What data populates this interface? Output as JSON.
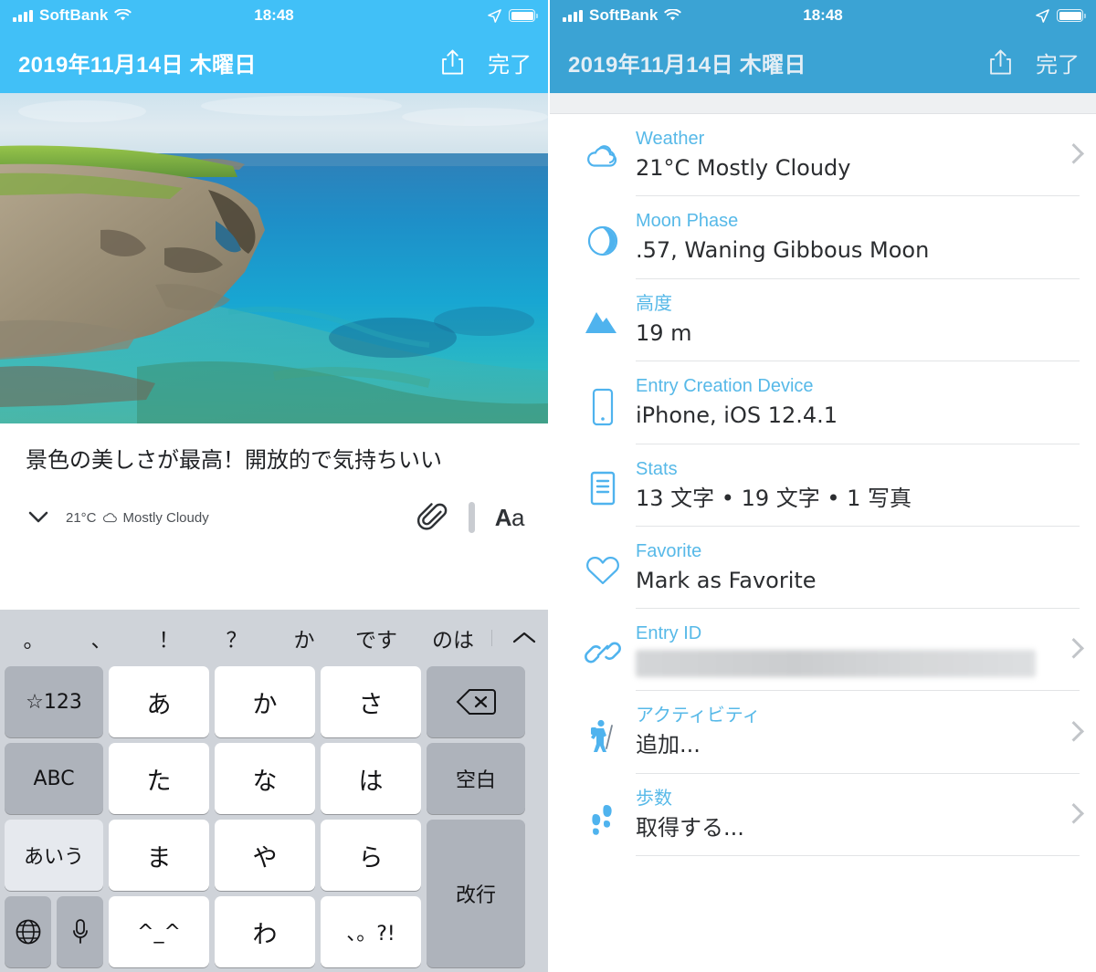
{
  "status_bar": {
    "carrier": "SoftBank",
    "time": "18:48",
    "wifi_icon": "wifi-icon",
    "signal_icon": "cellular-signal-icon",
    "location_icon": "location-arrow-icon",
    "battery_icon": "battery-full-icon"
  },
  "nav": {
    "title": "2019年11月14日 木曜日",
    "share_icon": "share-icon",
    "done_label": "完了"
  },
  "entry": {
    "photo_alt": "coastal-cliff-photo",
    "text": "景色の美しさが最高！開放的で気持ちいい",
    "weather_summary": "21°C",
    "weather_icon": "cloud-icon",
    "weather_condition": "Mostly Cloudy",
    "chevron_icon": "chevron-down-icon",
    "attach_icon": "paperclip-icon",
    "format_label": "Aa"
  },
  "keyboard": {
    "suggestions": [
      "。",
      "、",
      "！",
      "？",
      "か",
      "です",
      "のは"
    ],
    "collapse_icon": "chevron-up-icon",
    "rows": [
      [
        {
          "label": "☆123",
          "type": "fn",
          "name": "key-symbols"
        },
        {
          "label": "あ",
          "type": "main",
          "name": "key-a"
        },
        {
          "label": "か",
          "type": "main",
          "name": "key-ka"
        },
        {
          "label": "さ",
          "type": "main",
          "name": "key-sa"
        },
        {
          "label": "⌫",
          "type": "fn",
          "name": "key-delete"
        }
      ],
      [
        {
          "label": "ABC",
          "type": "fn",
          "name": "key-abc"
        },
        {
          "label": "た",
          "type": "main",
          "name": "key-ta"
        },
        {
          "label": "な",
          "type": "main",
          "name": "key-na"
        },
        {
          "label": "は",
          "type": "main",
          "name": "key-ha"
        },
        {
          "label": "空白",
          "type": "fn",
          "name": "key-space"
        }
      ],
      [
        {
          "label": "あいう",
          "type": "fn2",
          "name": "key-kana"
        },
        {
          "label": "ま",
          "type": "main",
          "name": "key-ma"
        },
        {
          "label": "や",
          "type": "main",
          "name": "key-ya"
        },
        {
          "label": "ら",
          "type": "main",
          "name": "key-ra"
        },
        {
          "label": "改行",
          "type": "fn",
          "name": "key-return"
        }
      ],
      [
        {
          "label": "🌐",
          "type": "fn",
          "name": "key-globe"
        },
        {
          "label": "🎤",
          "type": "fn",
          "name": "key-dictation"
        },
        {
          "label": "^_^",
          "type": "main",
          "name": "key-emoticon"
        },
        {
          "label": "わ",
          "type": "main",
          "name": "key-wa"
        },
        {
          "label": "、。?!",
          "type": "main",
          "name": "key-punctuation"
        }
      ]
    ]
  },
  "metadata": {
    "rows": [
      {
        "label": "Weather",
        "value": "21°C Mostly Cloudy",
        "icon": "cloud-icon",
        "name": "weather",
        "chevron": true,
        "redacted": false
      },
      {
        "label": "Moon Phase",
        "value": ".57, Waning Gibbous Moon",
        "icon": "moon-icon",
        "name": "moon-phase",
        "chevron": false,
        "redacted": false
      },
      {
        "label": "高度",
        "value": "19 m",
        "icon": "mountain-icon",
        "name": "altitude",
        "chevron": false,
        "redacted": false
      },
      {
        "label": "Entry Creation Device",
        "value": "iPhone, iOS 12.4.1",
        "icon": "phone-icon",
        "name": "entry-creation-device",
        "chevron": false,
        "redacted": false
      },
      {
        "label": "Stats",
        "value": "13 文字 • 19 文字 • 1 写真",
        "icon": "document-icon",
        "name": "stats",
        "chevron": false,
        "redacted": false
      },
      {
        "label": "Favorite",
        "value": "Mark as Favorite",
        "icon": "heart-icon",
        "name": "favorite",
        "chevron": false,
        "redacted": false
      },
      {
        "label": "Entry ID",
        "value": "",
        "icon": "link-icon",
        "name": "entry-id",
        "chevron": true,
        "redacted": true
      },
      {
        "label": "アクティビティ",
        "value": "追加...",
        "icon": "hiker-icon",
        "name": "activity",
        "chevron": true,
        "redacted": false
      },
      {
        "label": "歩数",
        "value": "取得する...",
        "icon": "footprints-icon",
        "name": "step-count",
        "chevron": true,
        "redacted": false
      }
    ]
  },
  "colors": {
    "accent_left": "#41c0f7",
    "accent_right": "#3ba3d4",
    "label_blue": "#57b9e8",
    "icon_blue": "#4fb3ee",
    "keyboard_bg": "#cfd3d9"
  }
}
